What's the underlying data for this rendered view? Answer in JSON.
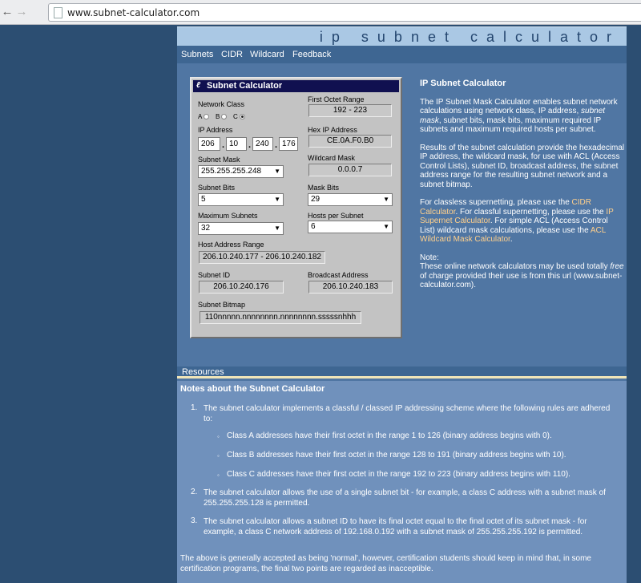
{
  "browser": {
    "url": "www.subnet-calculator.com",
    "back_icon": "arrow-left-icon",
    "forward_icon": "arrow-right-icon"
  },
  "banner": {
    "title": "ip subnet calculator"
  },
  "topnav": [
    "Subnets",
    "CIDR",
    "Wildcard",
    "Feedback"
  ],
  "calculator": {
    "title": "Subnet Calculator",
    "network_class": {
      "label": "Network Class",
      "options": [
        "A",
        "B",
        "C"
      ],
      "selected": "C"
    },
    "first_octet_range": {
      "label": "First Octet Range",
      "value": "192 - 223"
    },
    "ip_address": {
      "label": "IP Address",
      "octets": [
        "206",
        "10",
        "240",
        "176"
      ]
    },
    "hex_ip": {
      "label": "Hex IP Address",
      "value": "CE.0A.F0.B0"
    },
    "subnet_mask": {
      "label": "Subnet Mask",
      "value": "255.255.255.248"
    },
    "wildcard_mask": {
      "label": "Wildcard Mask",
      "value": "0.0.0.7"
    },
    "subnet_bits": {
      "label": "Subnet Bits",
      "value": "5"
    },
    "mask_bits": {
      "label": "Mask Bits",
      "value": "29"
    },
    "maximum_subnets": {
      "label": "Maximum Subnets",
      "value": "32"
    },
    "hosts_per_subnet": {
      "label": "Hosts per Subnet",
      "value": "6"
    },
    "host_address_range": {
      "label": "Host Address Range",
      "value": "206.10.240.177 - 206.10.240.182"
    },
    "subnet_id": {
      "label": "Subnet ID",
      "value": "206.10.240.176"
    },
    "broadcast_address": {
      "label": "Broadcast Address",
      "value": "206.10.240.183"
    },
    "subnet_bitmap": {
      "label": "Subnet Bitmap",
      "value": "110nnnnn.nnnnnnnn.nnnnnnnn.sssssnhhh"
    }
  },
  "description": {
    "heading": "IP Subnet Calculator",
    "p1_a": "The IP Subnet Mask Calculator enables subnet network calculations using network class, IP address, ",
    "p1_em": "subnet mask",
    "p1_b": ", subnet bits, mask bits, maximum required IP subnets and maximum required hosts per subnet.",
    "p2": "Results of the subnet calculation provide the hexadecimal IP address, the wildcard mask, for use with ACL (Access Control Lists), subnet ID, broadcast address, the subnet address range for the resulting subnet network and a subnet bitmap.",
    "p3_a": "For classless supernetting, please use the ",
    "p3_link1": "CIDR Calculator",
    "p3_b": ". For classful supernetting, please use the ",
    "p3_link2": "IP Supernet Calculator",
    "p3_c": ". For simple ACL (Access Control List) wildcard mask calculations, please use the ",
    "p3_link3": "ACL Wildcard Mask Calculator",
    "p3_d": ".",
    "note_label": "Note:",
    "note_a": "These online network calculators may be used totally ",
    "note_em": "free",
    "note_b": " of charge provided their use is from this url (www.subnet-calculator.com)."
  },
  "resources": {
    "label": "Resources"
  },
  "notes": {
    "heading": "Notes about the Subnet Calculator",
    "items": [
      {
        "num": "1.",
        "text": "The subnet calculator implements a classful / classed IP addressing scheme where the following rules are adhered to:"
      },
      {
        "num": "2.",
        "text": "The subnet calculator allows the use of a single subnet bit - for example, a class C address with a subnet mask of 255.255.255.128 is permitted."
      },
      {
        "num": "3.",
        "text": "The subnet calculator allows a subnet ID to have its final octet equal to the final octet of its subnet mask - for example, a class C network address of 192.168.0.192 with a subnet mask of 255.255.255.192 is permitted."
      }
    ],
    "subitems": [
      "Class A addresses have their first octet in the range 1 to 126 (binary address begins with 0).",
      "Class B addresses have their first octet in the range 128 to 191 (binary address begins with 10).",
      "Class C addresses have their first octet in the range 192 to 223 (binary address begins with 110)."
    ],
    "closing": "The above is generally accepted as being 'normal', however, certification students should keep in mind that, in some certification programs, the final two points are regarded as inacceptible."
  }
}
